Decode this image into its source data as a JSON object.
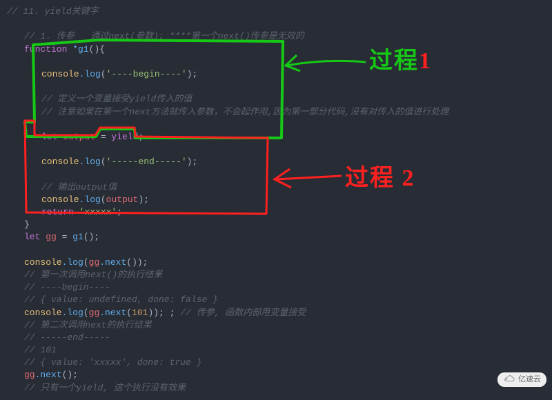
{
  "code": {
    "l1": "// 11. yield关键字",
    "l3": "// 1. 传参   通过next(参数); ****第一个next()传参是无效的",
    "l4_function": "function",
    "l4_star": " *",
    "l4_name": "g1",
    "l4_paren": "()",
    "l4_brace": "{",
    "l6_console": "console",
    "l6_log": ".log",
    "l6_open": "(",
    "l6_str": "'----begin----'",
    "l6_close": ");",
    "l8": "// 定义一个变量接受yield传入的值",
    "l9": "// 注意如果在第一个next方法就传入参数，不会起作用,因为第一部分代码,没有对传入的值进行处理",
    "l11_let": "let",
    "l11_output": " output",
    "l11_eq": " = ",
    "l11_yield": "yield",
    "l11_semi": ";",
    "l13_console": "console",
    "l13_log": ".log",
    "l13_open": "(",
    "l13_str": "'-----end-----'",
    "l13_close": ");",
    "l15": "// 输出output值",
    "l16_console": "console",
    "l16_log": ".log",
    "l16_open": "(",
    "l16_arg": "output",
    "l16_close": ");",
    "l17_return": "return",
    "l17_str": " 'xxxxx'",
    "l17_semi": ";",
    "l18_brace": "}",
    "l19_let": "let",
    "l19_gg": " gg",
    "l19_eq": " = ",
    "l19_g1": "g1",
    "l19_call": "();",
    "l21_console": "console",
    "l21_log": ".log",
    "l21_open": "(",
    "l21_gg": "gg",
    "l21_next": ".next",
    "l21_call": "());",
    "l22": "// 第一次调用next()的执行结果",
    "l23": "// ----begin----",
    "l24": "// { value: undefined, done: false }",
    "l25_console": "console",
    "l25_log": ".log",
    "l25_open": "(",
    "l25_gg": "gg",
    "l25_next": ".next",
    "l25_innerOpen": "(",
    "l25_num": "101",
    "l25_innerClose": "));",
    "l25_extra": " ; ",
    "l25_comment": "// 传参, 函数内部用变量接受",
    "l26": "// 第二次调用next的执行结果",
    "l27": "// -----end-----",
    "l28": "// 101",
    "l29": "// { value: 'xxxxx', done: true }",
    "l30_gg": "gg",
    "l30_next": ".next",
    "l30_call": "();",
    "l31": "// 只有一个yield, 这个执行没有效果"
  },
  "annotations": {
    "label1_prefix": "过程",
    "label1_suffix": "1",
    "label2_prefix": "过程",
    "label2_suffix": "2"
  },
  "watermark": "亿速云"
}
